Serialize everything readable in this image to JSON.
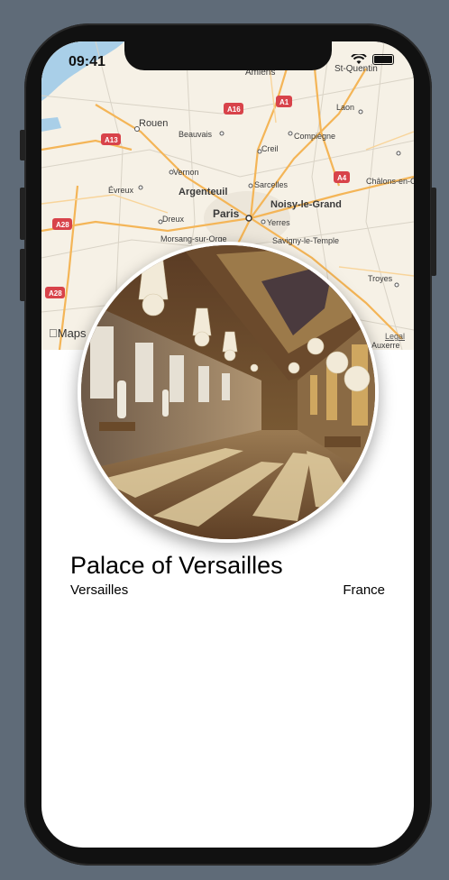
{
  "status": {
    "time": "09:41"
  },
  "map": {
    "credit": "Maps",
    "legal": "Legal",
    "labels": [
      {
        "text": "Amiens"
      },
      {
        "text": "St-Quentin"
      },
      {
        "text": "Rouen"
      },
      {
        "text": "Beauvais"
      },
      {
        "text": "Laon"
      },
      {
        "text": "Creil"
      },
      {
        "text": "Compiègne"
      },
      {
        "text": "Vernon"
      },
      {
        "text": "Évreux"
      },
      {
        "text": "Argenteuil"
      },
      {
        "text": "Sarcelles"
      },
      {
        "text": "Noisy-le-Grand"
      },
      {
        "text": "Paris"
      },
      {
        "text": "Dreux"
      },
      {
        "text": "Yerres"
      },
      {
        "text": "Morsang-sur-Orge"
      },
      {
        "text": "Savigny-le-Temple"
      },
      {
        "text": "Châlons-en-Champagne"
      },
      {
        "text": "Troyes"
      },
      {
        "text": "Auxerre"
      }
    ],
    "road_signs": [
      "A16",
      "A1",
      "A13",
      "A4",
      "A28",
      "A28"
    ]
  },
  "place": {
    "name": "Palace of Versailles",
    "city": "Versailles",
    "country": "France"
  }
}
